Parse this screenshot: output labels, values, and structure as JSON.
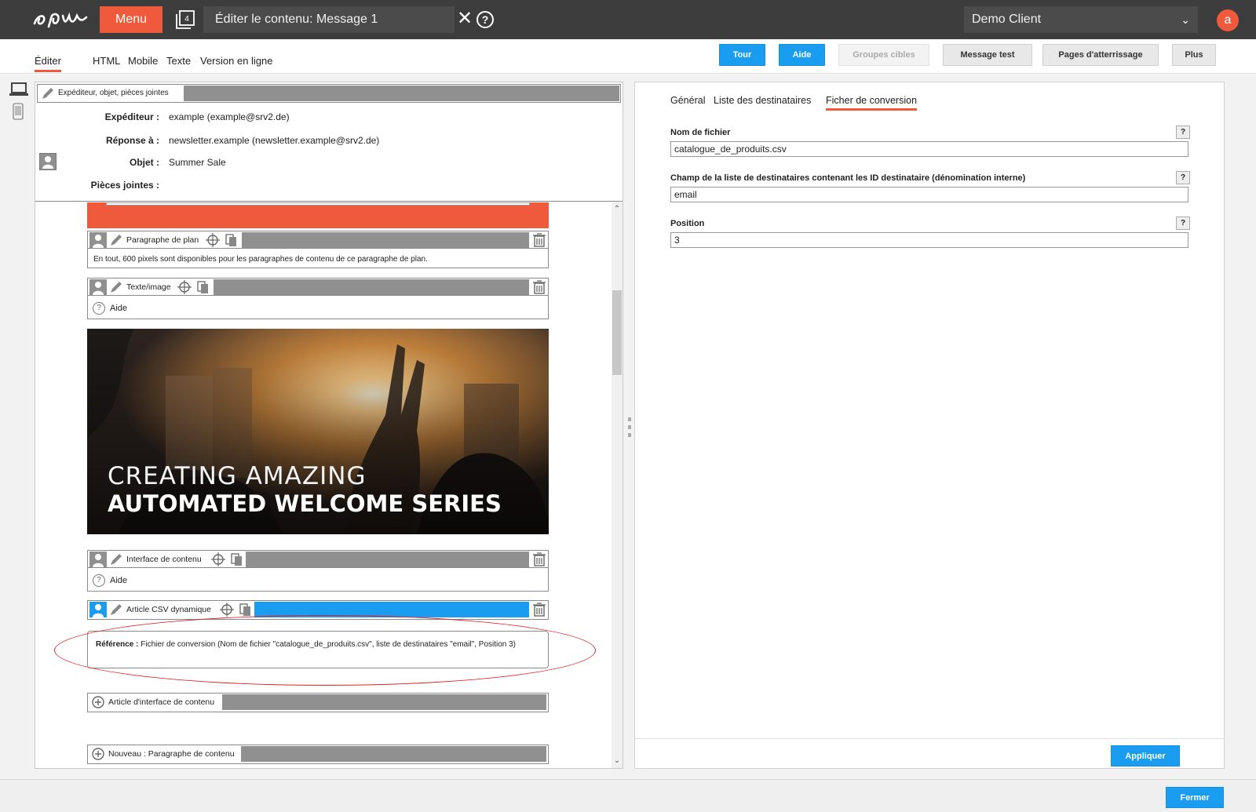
{
  "topbar": {
    "menu_label": "Menu",
    "windows_count": "4",
    "title": "Éditer le contenu: Message 1",
    "client": "Demo Client",
    "avatar_letter": "a"
  },
  "subtabs": [
    "Éditer",
    "HTML",
    "Mobile",
    "Texte",
    "Version en ligne"
  ],
  "toolbar": {
    "tour": "Tour",
    "aide": "Aide",
    "groupes_cibles": "Groupes cibles",
    "message_test": "Message test",
    "pages_atterrissage": "Pages d'atterrissage",
    "plus": "Plus"
  },
  "header_panel": {
    "strip_label": "Expéditeur, objet, pièces jointes",
    "sender_label": "Expéditeur :",
    "sender_value": "example (example@srv2.de)",
    "reply_label": "Réponse à :",
    "reply_value": "newsletter.example (newsletter.example@srv2.de)",
    "subject_label": "Objet :",
    "subject_value": "Summer Sale",
    "attachments_label": "Pièces jointes :"
  },
  "blocks": {
    "plan": {
      "label": "Paragraphe de plan",
      "text": "En tout, 600 pixels sont disponibles pour les paragraphes de contenu de ce paragraphe de plan."
    },
    "texte_image": {
      "label": "Texte/image",
      "aide": "Aide"
    },
    "hero": {
      "line1": "CREATING AMAZING",
      "line2": "AUTOMATED WELCOME SERIES"
    },
    "interface": {
      "label": "Interface de contenu",
      "aide": "Aide"
    },
    "csv": {
      "label": "Article CSV dynamique"
    },
    "reference": {
      "label": "Référence :",
      "text": "Fichier de conversion (Nom de fichier \"catalogue_de_produits.csv\", liste de destinataires \"email\", Position 3)"
    },
    "interface_article": {
      "label": "Article d'interface de contenu"
    },
    "nouveau": {
      "label": "Nouveau : Paragraphe de contenu"
    }
  },
  "right_panel": {
    "tabs": [
      "Général",
      "Liste des destinataires",
      "Ficher de conversion"
    ],
    "fields": [
      {
        "label": "Nom de fichier",
        "value": "catalogue_de_produits.csv"
      },
      {
        "label": "Champ de la liste de destinataires contenant les ID destinataire (dénomination interne)",
        "value": "email"
      },
      {
        "label": "Position",
        "value": "3"
      }
    ],
    "help_glyph": "?",
    "apply": "Appliquer"
  },
  "footer": {
    "close": "Fermer"
  },
  "colors": {
    "accent": "#f05a3c",
    "primary": "#1a9cf0",
    "topbar": "#3d3d3d",
    "highlight": "#e02020"
  }
}
